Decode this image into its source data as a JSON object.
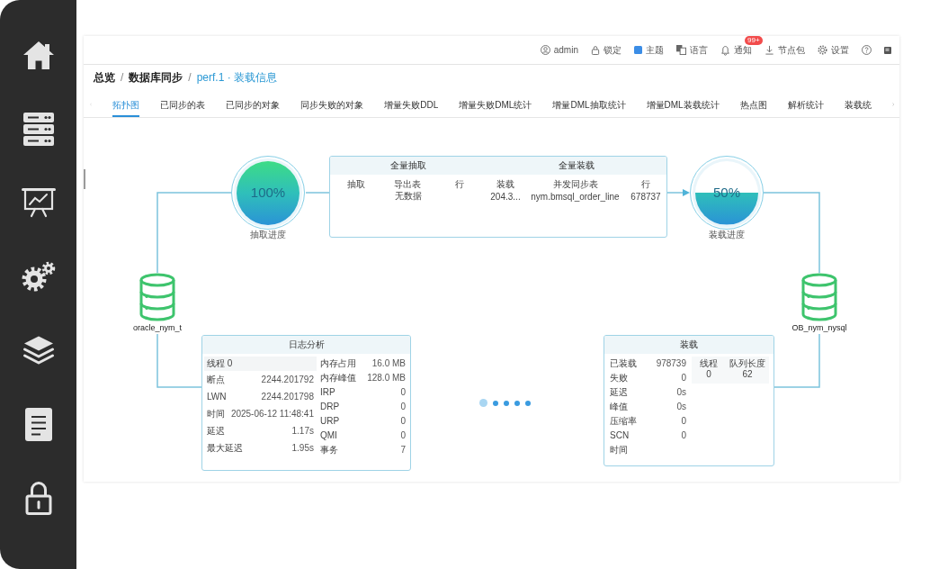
{
  "toolbar": [
    {
      "kind": "user",
      "label": "admin"
    },
    {
      "kind": "lock",
      "label": "锁定"
    },
    {
      "kind": "theme",
      "label": "主题"
    },
    {
      "kind": "language",
      "label": "语言"
    },
    {
      "kind": "notifications",
      "label": "通知",
      "badge": "99+"
    },
    {
      "kind": "download",
      "label": "节点包"
    },
    {
      "kind": "settings",
      "label": "设置"
    },
    {
      "kind": "help"
    },
    {
      "kind": "window"
    }
  ],
  "breadcrumb": [
    {
      "label": "总览",
      "current": false,
      "divider": "/"
    },
    {
      "label": "数据库同步",
      "current": false,
      "divider": "/"
    },
    {
      "label": "perf.1 · 装载信息",
      "current": true
    }
  ],
  "tabs": [
    {
      "label": "拓扑图",
      "selected": true
    },
    {
      "label": "已同步的表",
      "selected": false
    },
    {
      "label": "已同步的对象",
      "selected": false
    },
    {
      "label": "同步失败的对象",
      "selected": false
    },
    {
      "label": "增量失败DDL",
      "selected": false
    },
    {
      "label": "增量失败DML统计",
      "selected": false
    },
    {
      "label": "增量DML抽取统计",
      "selected": false
    },
    {
      "label": "增量DML装载统计",
      "selected": false
    },
    {
      "label": "热点图",
      "selected": false
    },
    {
      "label": "解析统计",
      "selected": false
    },
    {
      "label": "装载统",
      "selected": false
    }
  ],
  "topology": {
    "extract_gauge": {
      "value": "100%",
      "level": 1,
      "label": "抽取进度"
    },
    "full_sync": {
      "sections": [
        {
          "title": "全量抽取",
          "columns": [
            "抽取",
            "导出表",
            "行"
          ],
          "empty_text": "无数据"
        },
        {
          "title": "全量装载",
          "columns": [
            "装载",
            "并发同步表",
            "行"
          ],
          "rows": [
            [
              "204.3...",
              "nym.bmsql_order_line",
              "678737"
            ]
          ]
        }
      ]
    },
    "load_gauge": {
      "value": "50%",
      "level": 0.5,
      "label": "装载进度"
    },
    "source_db": {
      "label": "oracle_nym_t"
    },
    "target_db": {
      "label": "OB_nym_nysql"
    },
    "log_analysis": {
      "title": "日志分析",
      "thread": "线程 0",
      "left": [
        {
          "label": "断点",
          "value": "2244.201792"
        },
        {
          "label": "LWN",
          "value": "2244.201798"
        },
        {
          "label": "时间",
          "value": "2025-06-12 11:48:41"
        },
        {
          "label": "延迟",
          "value": "1.17s"
        },
        {
          "label": "最大延迟",
          "value": "1.95s"
        }
      ],
      "right": [
        {
          "label": "内存占用",
          "value": "16.0 MB"
        },
        {
          "label": "内存峰值",
          "value": "128.0 MB"
        },
        {
          "label": "IRP",
          "value": "0"
        },
        {
          "label": "DRP",
          "value": "0"
        },
        {
          "label": "URP",
          "value": "0"
        },
        {
          "label": "QMI",
          "value": "0"
        },
        {
          "label": "事务",
          "value": "7"
        }
      ]
    },
    "load_stats": {
      "title": "装载",
      "metrics": [
        {
          "label": "已装载",
          "value": "978739"
        },
        {
          "label": "失败",
          "value": "0"
        },
        {
          "label": "延迟",
          "value": "0s"
        },
        {
          "label": "峰值",
          "value": "0s"
        },
        {
          "label": "压缩率",
          "value": "0"
        },
        {
          "label": "SCN",
          "value": "0"
        },
        {
          "label": "时间"
        }
      ],
      "threads": {
        "columns": [
          "线程",
          "队列长度"
        ],
        "rows": [
          [
            "0",
            "62"
          ]
        ]
      }
    }
  },
  "pager": [
    {
      "selected": true
    },
    {
      "selected": false
    },
    {
      "selected": false
    },
    {
      "selected": false
    },
    {
      "selected": false
    }
  ]
}
